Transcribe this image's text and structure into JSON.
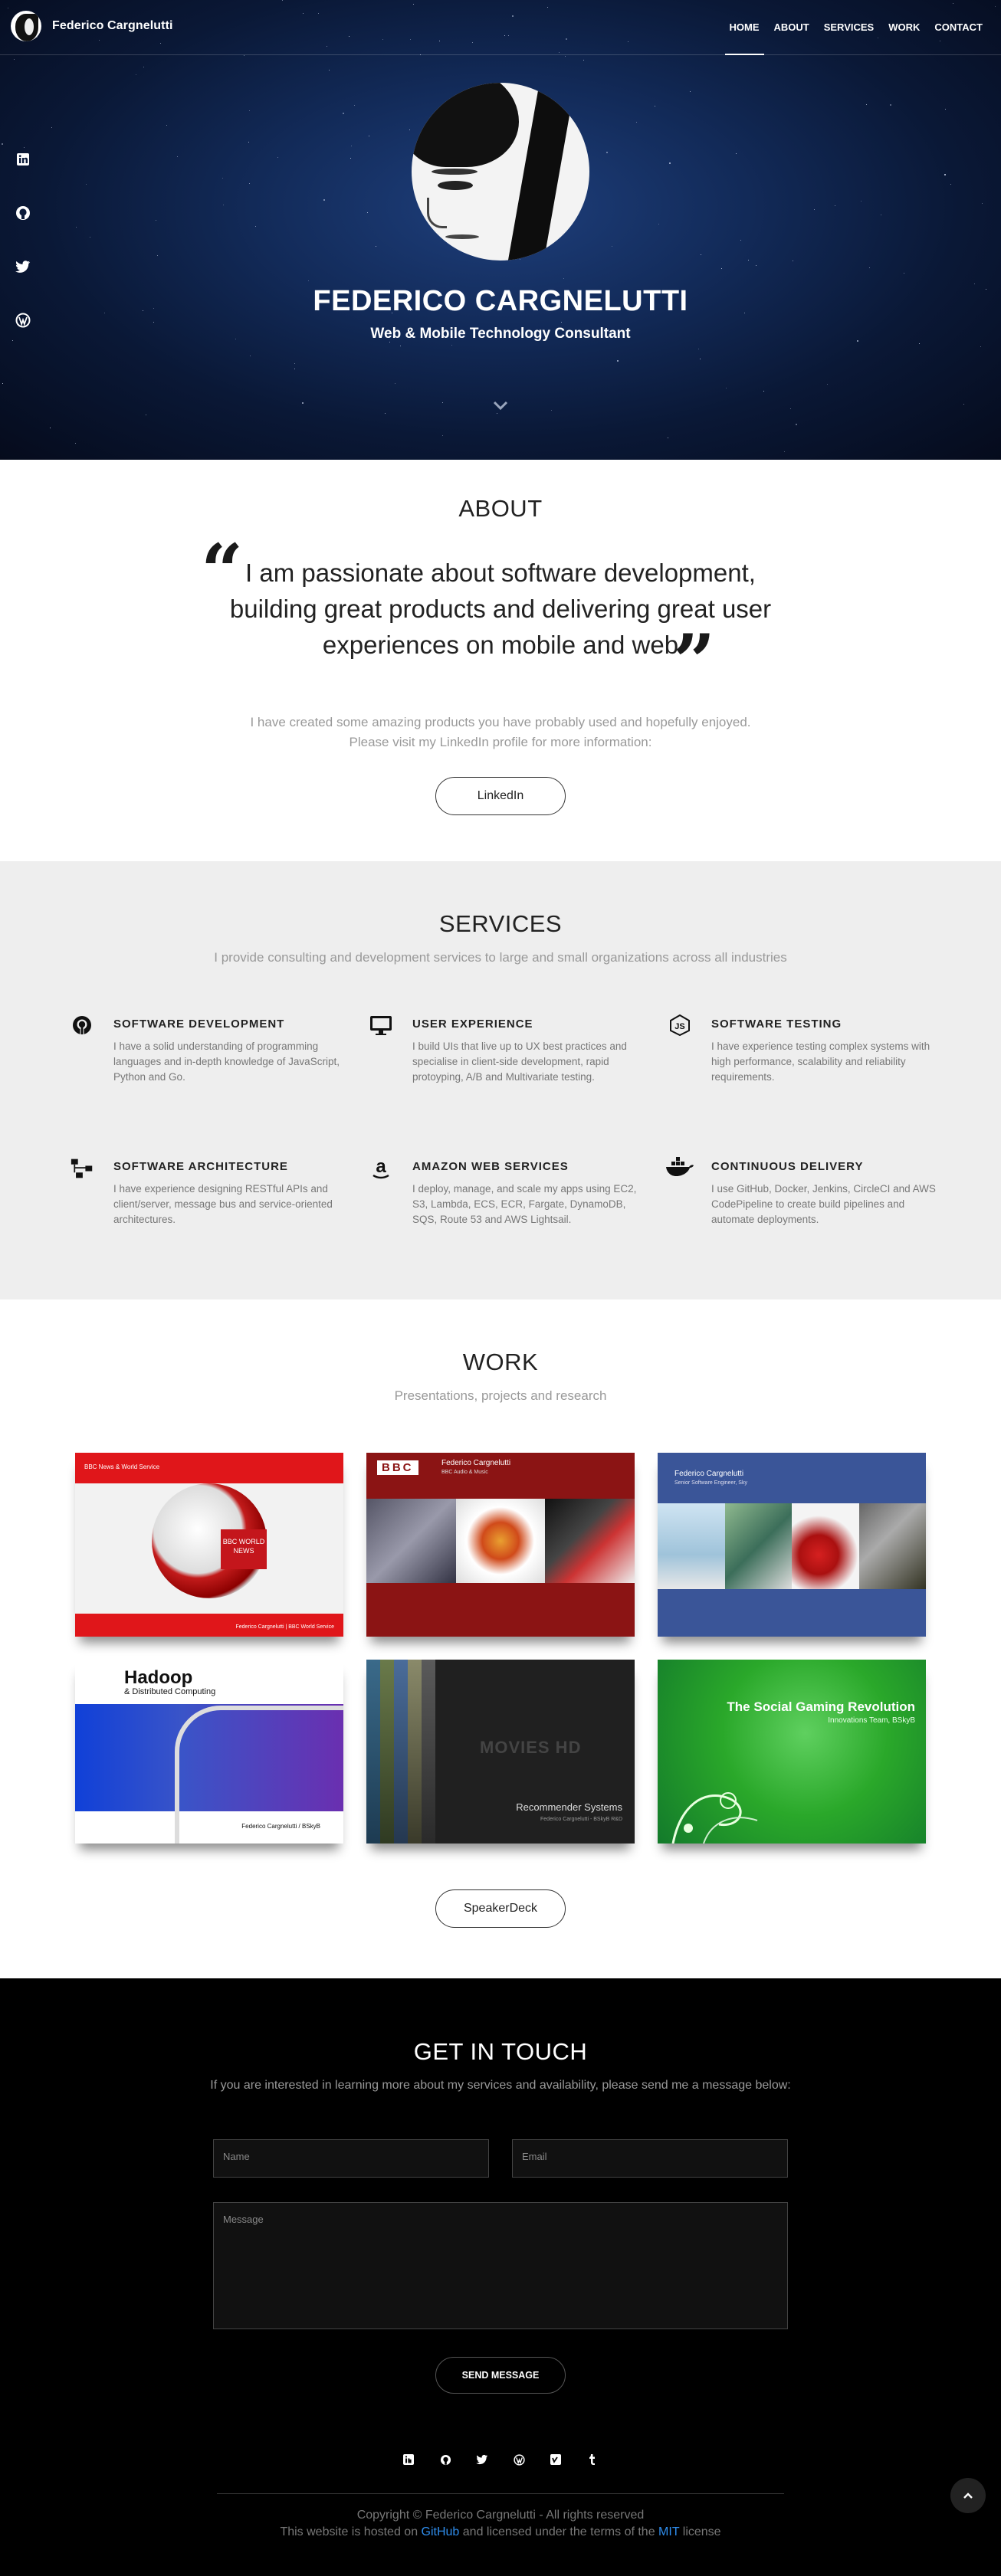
{
  "nav": {
    "brand": "Federico Cargnelutti",
    "links": [
      "HOME",
      "ABOUT",
      "SERVICES",
      "WORK",
      "CONTACT"
    ]
  },
  "hero": {
    "title": "FEDERICO CARGNELUTTI",
    "subtitle": "Web & Mobile Technology Consultant",
    "social_icons": [
      "linkedin-icon",
      "github-icon",
      "twitter-icon",
      "wordpress-icon"
    ]
  },
  "about": {
    "title": "ABOUT",
    "quote": "I am passionate about software development, building great products and delivering great user experiences on mobile and web",
    "text_line1": "I have created some amazing products you have probably used and hopefully enjoyed.",
    "text_line2": "Please visit my LinkedIn profile for more information:",
    "button": "LinkedIn"
  },
  "services": {
    "title": "SERVICES",
    "subtitle": "I provide consulting and development services to large and small organizations across all industries",
    "items": [
      {
        "icon": "github-icon",
        "title": "SOFTWARE DEVELOPMENT",
        "desc": "I have a solid understanding of programming languages and in-depth knowledge of JavaScript, Python and Go."
      },
      {
        "icon": "monitor-icon",
        "title": "USER EXPERIENCE",
        "desc": "I build UIs that live up to UX best practices and specialise in client-side development, rapid protoyping, A/B and Multivariate testing."
      },
      {
        "icon": "javascript-icon",
        "title": "SOFTWARE TESTING",
        "desc": "I have experience testing complex systems with high performance, scalability and reliability requirements."
      },
      {
        "icon": "sitemap-icon",
        "title": "SOFTWARE ARCHITECTURE",
        "desc": "I have experience designing RESTful APIs and client/server, message bus and service-oriented architectures."
      },
      {
        "icon": "amazon-icon",
        "title": "AMAZON WEB SERVICES",
        "desc": "I deploy, manage, and scale my apps using EC2, S3, Lambda, ECS, ECR, Fargate, DynamoDB, SQS, Route 53 and AWS Lightsail."
      },
      {
        "icon": "docker-icon",
        "title": "CONTINUOUS DELIVERY",
        "desc": "I use GitHub, Docker, Jenkins, CircleCI and AWS CodePipeline to create build pipelines and automate deployments."
      }
    ]
  },
  "work": {
    "title": "WORK",
    "subtitle": "Presentations, projects and research",
    "thumbs": {
      "t1_header": "BBC News & World Service",
      "t1_badge": "BBC WORLD NEWS",
      "t1_footer": "Federico Cargnelutti | BBC World Service",
      "t2_logo": "BBC",
      "t2_name": "Federico Cargnelutti",
      "t2_role": "BBC Audio & Music",
      "t3_name": "Federico Cargnelutti",
      "t3_role": "Senior Software Engineer, Sky",
      "t4_title": "Hadoop",
      "t4_sub": "& Distributed Computing",
      "t4_footer": "Federico Cargnelutti / BSkyB",
      "t5_logo": "MOVIES HD",
      "t5_title": "Recommender Systems",
      "t5_sub": "Federico Cargnelutti - BSkyB R&D",
      "t6_title": "The Social Gaming Revolution",
      "t6_sub": "Innovations Team, BSkyB"
    },
    "button": "SpeakerDeck"
  },
  "contact": {
    "title": "GET IN TOUCH",
    "subtitle": "If you are interested in learning more about my services and availability, please send me a message below:",
    "name_placeholder": "Name",
    "email_placeholder": "Email",
    "message_placeholder": "Message",
    "send": "SEND MESSAGE"
  },
  "footer": {
    "icons": [
      "linkedin-icon",
      "github-icon",
      "twitter-icon",
      "wordpress-icon",
      "vimeo-icon",
      "tumblr-icon"
    ],
    "copyright": "Copyright © Federico Cargnelutti - All rights reserved",
    "hosted_pre": "This website is hosted on ",
    "hosted_link": "GitHub",
    "hosted_mid": " and licensed under the terms of the ",
    "license_link": "MIT",
    "hosted_post": " license"
  }
}
